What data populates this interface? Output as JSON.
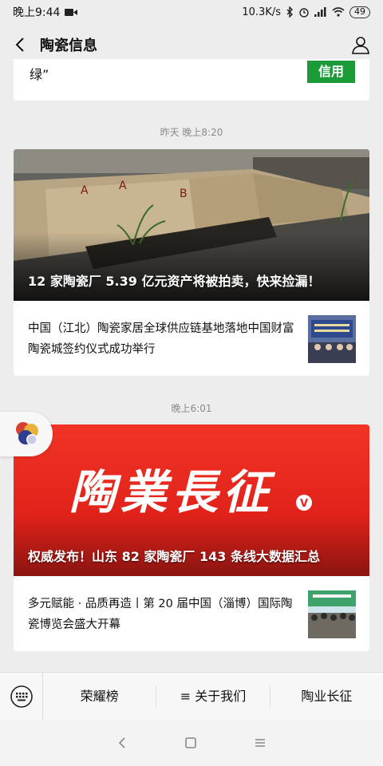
{
  "status_bar": {
    "time": "晚上9:44",
    "network_speed": "10.3K/s",
    "battery": "49"
  },
  "header": {
    "title": "陶瓷信息"
  },
  "top_card": {
    "tail_text": "绿”",
    "button_label": "信用"
  },
  "messages": [
    {
      "timestamp": "昨天 晚上8:20",
      "headline": "12 家陶瓷厂 5.39 亿元资产将被拍卖，快来捡漏！",
      "sub_article": "中国（江北）陶瓷家居全球供应链基地落地中国财富陶瓷城签约仪式成功举行"
    },
    {
      "timestamp": "晚上6:01",
      "banner_text": "陶業長征",
      "headline": "权威发布！山东 82 家陶瓷厂 143 条线大数据汇总",
      "sub_article": "多元赋能 · 品质再造丨第 20 届中国（淄博）国际陶瓷博览会盛大开幕"
    }
  ],
  "bottom_menu": {
    "items": [
      "荣耀榜",
      "≡ 关于我们",
      "陶业长征"
    ]
  },
  "colors": {
    "accent_green": "#1c9a37",
    "banner_red": "#e8261f",
    "background": "#ededed"
  }
}
